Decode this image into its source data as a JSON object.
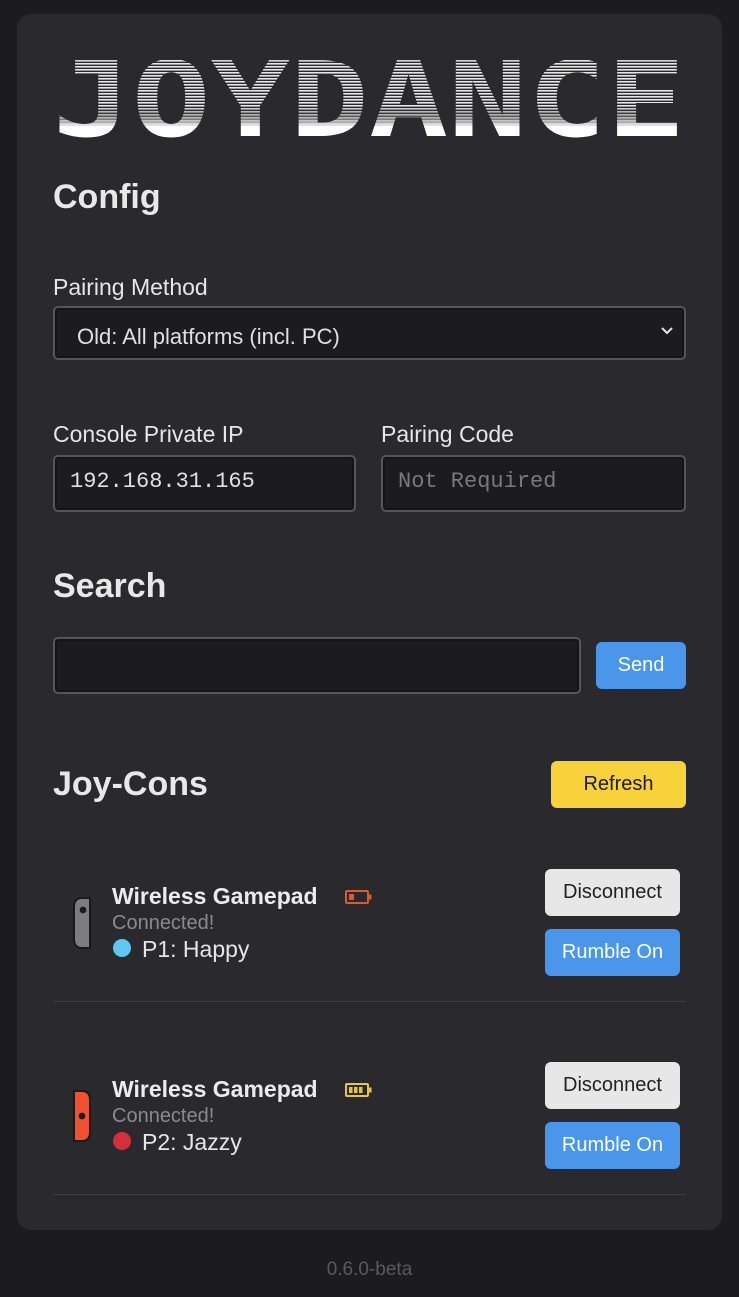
{
  "logo": {
    "text": "JOYDANCE"
  },
  "config": {
    "heading": "Config",
    "pairing_method_label": "Pairing Method",
    "pairing_method_value": "Old: All platforms (incl. PC)",
    "console_ip_label": "Console Private IP",
    "console_ip_value": "192.168.31.165",
    "pairing_code_label": "Pairing Code",
    "pairing_code_placeholder": "Not Required"
  },
  "search": {
    "heading": "Search",
    "value": "",
    "send_label": "Send"
  },
  "joycons": {
    "heading": "Joy-Cons",
    "refresh_label": "Refresh",
    "items": [
      {
        "name": "Wireless Gamepad",
        "status": "Connected!",
        "player": "P1: Happy",
        "player_color": "#5ec8f2",
        "battery_icon": "battery-low-icon",
        "battery_color": "#e0592a",
        "battery_level": 0.25,
        "controller_icon": "joycon-gray-icon",
        "controller_color": "#7d7d80",
        "disconnect_label": "Disconnect",
        "rumble_label": "Rumble On"
      },
      {
        "name": "Wireless Gamepad",
        "status": "Connected!",
        "player": "P2: Jazzy",
        "player_color": "#d3303a",
        "battery_icon": "battery-medium-icon",
        "battery_color": "#e8c53a",
        "battery_level": 0.75,
        "controller_icon": "joycon-red-icon",
        "controller_color": "#f0522f",
        "disconnect_label": "Disconnect",
        "rumble_label": "Rumble On"
      }
    ]
  },
  "footer": {
    "version": "0.6.0-beta"
  },
  "colors": {
    "background": "#1c1c20",
    "card": "#2a2a2e",
    "accent_blue": "#4a96ea",
    "accent_yellow": "#f7d23a"
  }
}
